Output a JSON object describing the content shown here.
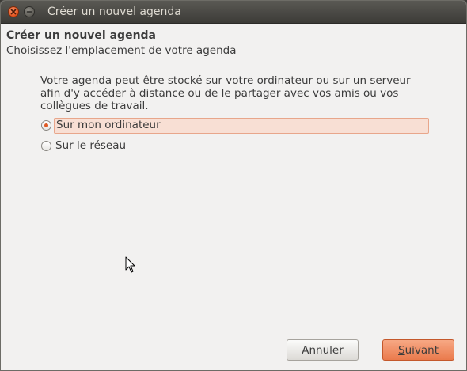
{
  "window": {
    "title": "Créer un nouvel agenda"
  },
  "header": {
    "title": "Créer un nouvel agenda",
    "subtitle": "Choisissez l'emplacement de votre agenda"
  },
  "content": {
    "description": "Votre agenda peut être stocké sur votre ordinateur ou sur un serveur afin d'y accéder à distance ou de le partager avec vos amis ou vos collègues de travail.",
    "options": [
      {
        "label": "Sur mon ordinateur",
        "selected": true
      },
      {
        "label": "Sur le réseau",
        "selected": false
      }
    ]
  },
  "buttons": {
    "cancel": "Annuler",
    "next_mnemonic": "S",
    "next_rest": "uivant"
  },
  "colors": {
    "accent": "#e05a25",
    "selection_bg": "#f8dfd4"
  }
}
